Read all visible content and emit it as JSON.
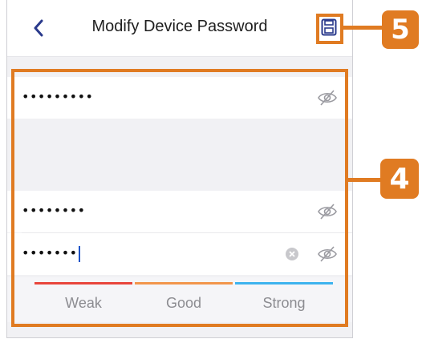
{
  "header": {
    "title": "Modify Device Password"
  },
  "fields": {
    "old_password_value": "•••••••••",
    "new_password_value": "••••••••",
    "confirm_password_value": "•••••••"
  },
  "strength": {
    "weak_label": "Weak",
    "good_label": "Good",
    "strong_label": "Strong",
    "weak_color": "#e8453c",
    "good_color": "#f2954b",
    "strong_color": "#3db3ee"
  },
  "annotations": {
    "save_callout_number": "5",
    "form_callout_number": "4",
    "callout_color": "#e07b22"
  },
  "icons": {
    "back": "chevron-left-icon",
    "save": "save-floppy-icon",
    "eye": "eye-off-icon",
    "clear": "clear-circle-icon"
  }
}
